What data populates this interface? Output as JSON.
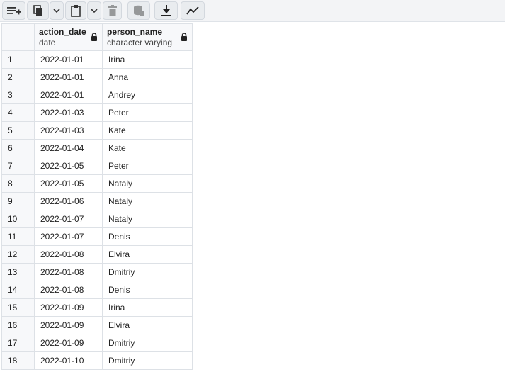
{
  "toolbar": {
    "buttons": [
      {
        "name": "add-row",
        "icon": "add-row-icon"
      },
      {
        "name": "copy",
        "icon": "copy-icon"
      },
      {
        "name": "copy-options",
        "icon": "chevron-down-icon"
      },
      {
        "name": "paste",
        "icon": "paste-icon"
      },
      {
        "name": "paste-options",
        "icon": "chevron-down-icon"
      },
      {
        "name": "delete",
        "icon": "trash-icon"
      },
      {
        "name": "save-data",
        "icon": "database-save-icon"
      },
      {
        "name": "download",
        "icon": "download-icon"
      },
      {
        "name": "graph-visualiser",
        "icon": "line-chart-icon"
      }
    ]
  },
  "grid": {
    "columns": [
      {
        "name": "action_date",
        "type": "date",
        "locked": true
      },
      {
        "name": "person_name",
        "type": "character varying",
        "locked": true
      }
    ],
    "rows": [
      {
        "n": "1",
        "action_date": "2022-01-01",
        "person_name": "Irina"
      },
      {
        "n": "2",
        "action_date": "2022-01-01",
        "person_name": "Anna"
      },
      {
        "n": "3",
        "action_date": "2022-01-01",
        "person_name": "Andrey"
      },
      {
        "n": "4",
        "action_date": "2022-01-03",
        "person_name": "Peter"
      },
      {
        "n": "5",
        "action_date": "2022-01-03",
        "person_name": "Kate"
      },
      {
        "n": "6",
        "action_date": "2022-01-04",
        "person_name": "Kate"
      },
      {
        "n": "7",
        "action_date": "2022-01-05",
        "person_name": "Peter"
      },
      {
        "n": "8",
        "action_date": "2022-01-05",
        "person_name": "Nataly"
      },
      {
        "n": "9",
        "action_date": "2022-01-06",
        "person_name": "Nataly"
      },
      {
        "n": "10",
        "action_date": "2022-01-07",
        "person_name": "Nataly"
      },
      {
        "n": "11",
        "action_date": "2022-01-07",
        "person_name": "Denis"
      },
      {
        "n": "12",
        "action_date": "2022-01-08",
        "person_name": "Elvira"
      },
      {
        "n": "13",
        "action_date": "2022-01-08",
        "person_name": "Dmitriy"
      },
      {
        "n": "14",
        "action_date": "2022-01-08",
        "person_name": "Denis"
      },
      {
        "n": "15",
        "action_date": "2022-01-09",
        "person_name": "Irina"
      },
      {
        "n": "16",
        "action_date": "2022-01-09",
        "person_name": "Elvira"
      },
      {
        "n": "17",
        "action_date": "2022-01-09",
        "person_name": "Dmitriy"
      },
      {
        "n": "18",
        "action_date": "2022-01-10",
        "person_name": "Dmitriy"
      }
    ]
  }
}
